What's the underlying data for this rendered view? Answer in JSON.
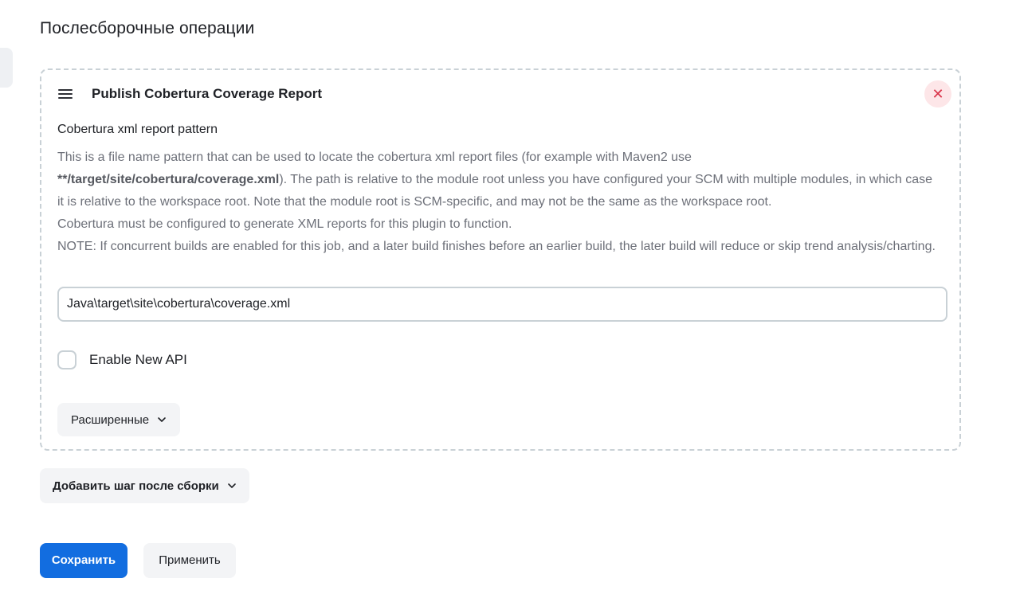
{
  "section": {
    "title": "Послесборочные операции"
  },
  "step": {
    "title": "Publish Cobertura Coverage Report",
    "delete_icon": "close-icon",
    "drag_icon": "hamburger-icon",
    "field_label": "Cobertura xml report pattern",
    "help": {
      "line1_prefix": "This is a file name pattern that can be used to locate the cobertura xml report files (for example with Maven2 use",
      "path_example": "**/target/site/cobertura/coverage.xml",
      "line2_suffix": "). The path is relative to the module root unless you have configured your SCM with multiple modules, in which case it is relative to the workspace root. Note that the module root is SCM-specific, and may not be the same as the workspace root.",
      "line3": "Cobertura must be configured to generate XML reports for this plugin to function.",
      "note": "NOTE: If concurrent builds are enabled for this job, and a later build finishes before an earlier build, the later build will reduce or skip trend analysis/charting."
    },
    "pattern_value": "Java\\target\\site\\cobertura\\coverage.xml",
    "enable_new_api_label": "Enable New API",
    "enable_new_api_checked": false,
    "advanced_label": "Расширенные"
  },
  "actions": {
    "add_step_label": "Добавить шаг после сборки",
    "save_label": "Сохранить",
    "apply_label": "Применить"
  },
  "colors": {
    "primary": "#126de0",
    "delete_bg": "#fde6e8",
    "delete_fg": "#d9344a",
    "help_text": "#6d7079",
    "border": "#c9d1d6"
  }
}
